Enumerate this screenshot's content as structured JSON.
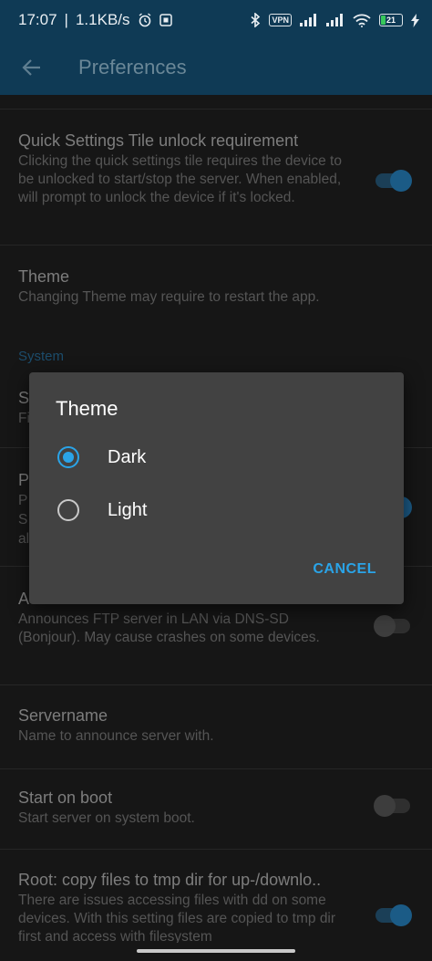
{
  "status_bar": {
    "time": "17:07",
    "net_speed": "1.1KB/s",
    "vpn": "VPN",
    "battery": "21"
  },
  "app_bar": {
    "title": "Preferences"
  },
  "settings": [
    {
      "title": "Quick Settings Tile unlock requirement",
      "summary": "Clicking the quick settings tile requires the device to be unlocked to start/stop the server. When enabled, will prompt to unlock the device if it's locked.",
      "switch": true
    },
    {
      "title": "Theme",
      "summary": "Changing Theme may require to restart the app."
    },
    {
      "title": "S",
      "summary": "Fi"
    },
    {
      "title": "P",
      "summary": "P",
      "summary2": "S",
      "summary3": "al",
      "switch": true
    },
    {
      "title": "A",
      "summary": "Announces FTP server in LAN via DNS-SD (Bonjour). May cause crashes on some devices.",
      "switch": false
    },
    {
      "title": "Servername",
      "summary": "Name to announce server with."
    },
    {
      "title": "Start on boot",
      "summary": "Start server on system boot.",
      "switch": false
    },
    {
      "title": "Root: copy files to tmp dir for up-/downlo..",
      "summary": "There are issues accessing files with dd on some devices. With this setting files are copied to tmp dir first and access with filesystem",
      "switch": true
    }
  ],
  "section_system": "System",
  "dialog": {
    "title": "Theme",
    "options": [
      {
        "label": "Dark",
        "selected": true
      },
      {
        "label": "Light",
        "selected": false
      }
    ],
    "cancel": "CANCEL"
  },
  "colors": {
    "accent": "#2aa4e8",
    "dialog_bg": "#424242",
    "app_bar": "#0f3a55"
  }
}
